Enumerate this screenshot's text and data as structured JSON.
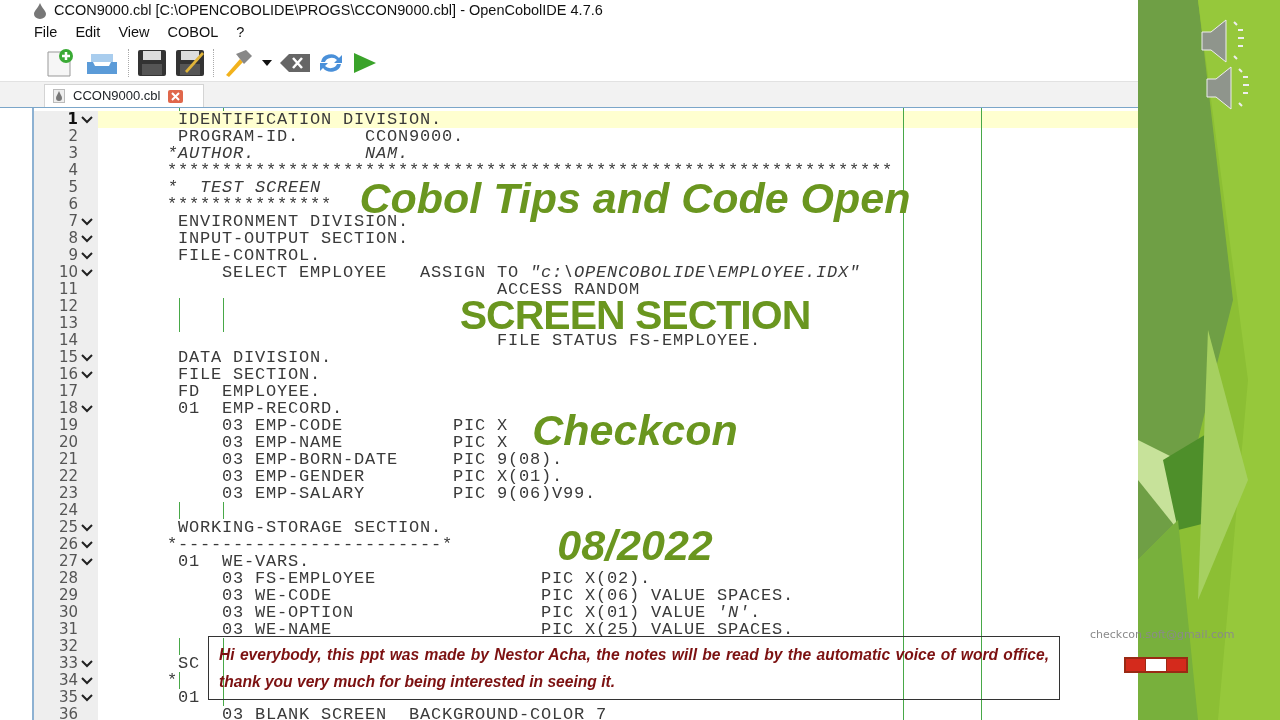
{
  "window": {
    "title": "CCON9000.cbl [C:\\OPENCOBOLIDE\\PROGS\\CCON9000.cbl] - OpenCobolIDE 4.7.6"
  },
  "menu": [
    {
      "label": "File"
    },
    {
      "label": "Edit"
    },
    {
      "label": "View"
    },
    {
      "label": "COBOL"
    },
    {
      "label": "?"
    }
  ],
  "tabs": [
    {
      "label": "CCON9000.cbl",
      "selected": true
    }
  ],
  "editor": {
    "lines": [
      {
        "number": "1",
        "foldable": true,
        "current": true,
        "kind": "code",
        "text": "       IDENTIFICATION DIVISION."
      },
      {
        "number": "2",
        "foldable": false,
        "current": false,
        "kind": "code",
        "text": "       PROGRAM-ID.      CCON9000."
      },
      {
        "number": "3",
        "foldable": false,
        "current": false,
        "kind": "comment",
        "text": "      *AUTHOR.          NAM."
      },
      {
        "number": "4",
        "foldable": false,
        "current": false,
        "kind": "code",
        "text": "      ******************************************************************"
      },
      {
        "number": "5",
        "foldable": false,
        "current": false,
        "kind": "comment",
        "text": "      *  TEST SCREEN"
      },
      {
        "number": "6",
        "foldable": false,
        "current": false,
        "kind": "code",
        "text": "      ***************"
      },
      {
        "number": "7",
        "foldable": true,
        "current": false,
        "kind": "code",
        "text": "       ENVIRONMENT DIVISION."
      },
      {
        "number": "8",
        "foldable": true,
        "current": false,
        "kind": "code",
        "text": "       INPUT-OUTPUT SECTION."
      },
      {
        "number": "9",
        "foldable": true,
        "current": false,
        "kind": "code",
        "text": "       FILE-CONTROL."
      },
      {
        "number": "10",
        "foldable": true,
        "current": false,
        "kind": "rich",
        "text": "           SELECT EMPLOYEE   ASSIGN TO *\"c:\\OPENCOBOLIDE\\EMPLOYEE.IDX\"*"
      },
      {
        "number": "11",
        "foldable": false,
        "current": false,
        "kind": "code",
        "text": "                                    ACCESS RANDOM"
      },
      {
        "number": "12",
        "foldable": false,
        "current": false,
        "kind": "code"
      },
      {
        "number": "13",
        "foldable": false,
        "current": false,
        "kind": "code"
      },
      {
        "number": "14",
        "foldable": false,
        "current": false,
        "kind": "code",
        "text": "                                    FILE STATUS FS-EMPLOYEE."
      },
      {
        "number": "15",
        "foldable": true,
        "current": false,
        "kind": "code",
        "text": "       DATA DIVISION."
      },
      {
        "number": "16",
        "foldable": true,
        "current": false,
        "kind": "code",
        "text": "       FILE SECTION."
      },
      {
        "number": "17",
        "foldable": false,
        "current": false,
        "kind": "code",
        "text": "       FD  EMPLOYEE."
      },
      {
        "number": "18",
        "foldable": true,
        "current": false,
        "kind": "code",
        "text": "       01  EMP-RECORD."
      },
      {
        "number": "19",
        "foldable": false,
        "current": false,
        "kind": "code",
        "text": "           03 EMP-CODE          PIC X"
      },
      {
        "number": "20",
        "foldable": false,
        "current": false,
        "kind": "code",
        "text": "           03 EMP-NAME          PIC X"
      },
      {
        "number": "21",
        "foldable": false,
        "current": false,
        "kind": "code",
        "text": "           03 EMP-BORN-DATE     PIC 9(08)."
      },
      {
        "number": "22",
        "foldable": false,
        "current": false,
        "kind": "code",
        "text": "           03 EMP-GENDER        PIC X(01)."
      },
      {
        "number": "23",
        "foldable": false,
        "current": false,
        "kind": "code",
        "text": "           03 EMP-SALARY        PIC 9(06)V99."
      },
      {
        "number": "24",
        "foldable": false,
        "current": false,
        "kind": "code"
      },
      {
        "number": "25",
        "foldable": true,
        "current": false,
        "kind": "code",
        "text": "       WORKING-STORAGE SECTION."
      },
      {
        "number": "26",
        "foldable": true,
        "current": false,
        "kind": "code",
        "text": "      *------------------------*"
      },
      {
        "number": "27",
        "foldable": true,
        "current": false,
        "kind": "code",
        "text": "       01  WE-VARS."
      },
      {
        "number": "28",
        "foldable": false,
        "current": false,
        "kind": "code",
        "text": "           03 FS-EMPLOYEE               PIC X(02)."
      },
      {
        "number": "29",
        "foldable": false,
        "current": false,
        "kind": "code",
        "text": "           03 WE-CODE                   PIC X(06) VALUE SPACES."
      },
      {
        "number": "30",
        "foldable": false,
        "current": false,
        "kind": "rich",
        "text": "           03 WE-OPTION                 PIC X(01) VALUE *'N'*."
      },
      {
        "number": "31",
        "foldable": false,
        "current": false,
        "kind": "code",
        "text": "           03 WE-NAME                   PIC X(25) VALUE SPACES."
      },
      {
        "number": "32",
        "foldable": false,
        "current": false,
        "kind": "code"
      },
      {
        "number": "33",
        "foldable": true,
        "current": false,
        "kind": "code",
        "text": "       SC"
      },
      {
        "number": "34",
        "foldable": true,
        "current": false,
        "kind": "code",
        "text": "      *"
      },
      {
        "number": "35",
        "foldable": true,
        "current": false,
        "kind": "code",
        "text": "       01"
      },
      {
        "number": "36",
        "foldable": false,
        "current": false,
        "kind": "code",
        "text": "           03 BLANK SCREEN  BACKGROUND-COLOR 7"
      }
    ]
  },
  "slide": {
    "titles": [
      {
        "text": "Cobol Tips and Code Open",
        "italic": true
      },
      {
        "text": "SCREEN SECTION",
        "italic": false
      },
      {
        "text": "Checkcon",
        "italic": true
      },
      {
        "text": "08/2022",
        "italic": true
      }
    ],
    "notes": "Hi everybody, this ppt was made by Nestor Acha, the notes will be read by the automatic voice of word office, thank you very much for being interested in seeing it.",
    "email": "checkcon.soft@gmail.com"
  }
}
